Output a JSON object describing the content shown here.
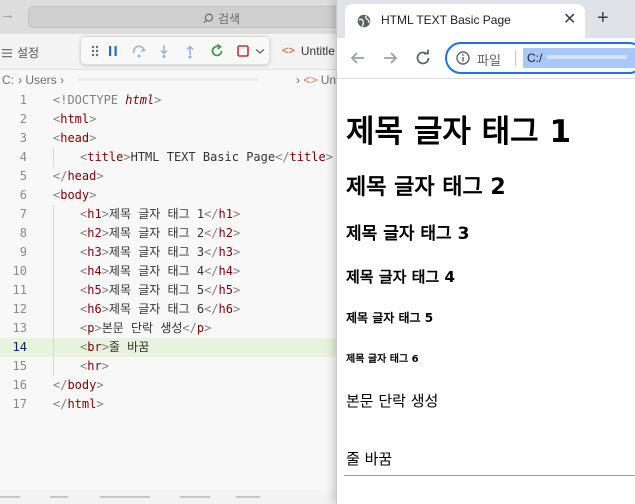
{
  "vscode": {
    "search_placeholder": "검색",
    "settings_label": "설정",
    "tab_label": "Untitle",
    "breadcrumb": {
      "drive": "C:",
      "folder": "Users",
      "right_tag": "<>",
      "right_label": "Untit"
    },
    "code_lines": [
      {
        "num": "1",
        "parts": [
          [
            "b",
            "<!DOCTYPE "
          ],
          [
            "d",
            "html"
          ],
          [
            "b",
            ">"
          ]
        ]
      },
      {
        "num": "2",
        "parts": [
          [
            "b",
            "<"
          ],
          [
            "t",
            "html"
          ],
          [
            "b",
            ">"
          ]
        ]
      },
      {
        "num": "3",
        "parts": [
          [
            "b",
            "<"
          ],
          [
            "t",
            "head"
          ],
          [
            "b",
            ">"
          ]
        ]
      },
      {
        "num": "4",
        "parts": [
          [
            "b",
            "<"
          ],
          [
            "t",
            "title"
          ],
          [
            "b",
            ">"
          ],
          [
            "x",
            "HTML TEXT Basic Page"
          ],
          [
            "b",
            "</"
          ],
          [
            "t",
            "title"
          ],
          [
            "b",
            ">"
          ]
        ]
      },
      {
        "num": "5",
        "parts": [
          [
            "b",
            "</"
          ],
          [
            "t",
            "head"
          ],
          [
            "b",
            ">"
          ]
        ]
      },
      {
        "num": "6",
        "parts": [
          [
            "b",
            "<"
          ],
          [
            "t",
            "body"
          ],
          [
            "b",
            ">"
          ]
        ]
      },
      {
        "num": "7",
        "parts": [
          [
            "b",
            "<"
          ],
          [
            "t",
            "h1"
          ],
          [
            "b",
            ">"
          ],
          [
            "x",
            "제목 글자 태그 1"
          ],
          [
            "b",
            "</"
          ],
          [
            "t",
            "h1"
          ],
          [
            "b",
            ">"
          ]
        ]
      },
      {
        "num": "8",
        "parts": [
          [
            "b",
            "<"
          ],
          [
            "t",
            "h2"
          ],
          [
            "b",
            ">"
          ],
          [
            "x",
            "제목 글자 태그 2"
          ],
          [
            "b",
            "</"
          ],
          [
            "t",
            "h2"
          ],
          [
            "b",
            ">"
          ]
        ]
      },
      {
        "num": "9",
        "parts": [
          [
            "b",
            "<"
          ],
          [
            "t",
            "h3"
          ],
          [
            "b",
            ">"
          ],
          [
            "x",
            "제목 글자 태그 3"
          ],
          [
            "b",
            "</"
          ],
          [
            "t",
            "h3"
          ],
          [
            "b",
            ">"
          ]
        ]
      },
      {
        "num": "10",
        "parts": [
          [
            "b",
            "<"
          ],
          [
            "t",
            "h4"
          ],
          [
            "b",
            ">"
          ],
          [
            "x",
            "제목 글자 태그 4"
          ],
          [
            "b",
            "</"
          ],
          [
            "t",
            "h4"
          ],
          [
            "b",
            ">"
          ]
        ]
      },
      {
        "num": "11",
        "parts": [
          [
            "b",
            "<"
          ],
          [
            "t",
            "h5"
          ],
          [
            "b",
            ">"
          ],
          [
            "x",
            "제목 글자 태그 5"
          ],
          [
            "b",
            "</"
          ],
          [
            "t",
            "h5"
          ],
          [
            "b",
            ">"
          ]
        ]
      },
      {
        "num": "12",
        "parts": [
          [
            "b",
            "<"
          ],
          [
            "t",
            "h6"
          ],
          [
            "b",
            ">"
          ],
          [
            "x",
            "제목 글자 태그 6"
          ],
          [
            "b",
            "</"
          ],
          [
            "t",
            "h6"
          ],
          [
            "b",
            ">"
          ]
        ]
      },
      {
        "num": "13",
        "parts": [
          [
            "b",
            "<"
          ],
          [
            "t",
            "p"
          ],
          [
            "b",
            ">"
          ],
          [
            "x",
            "본문 단락 생성"
          ],
          [
            "b",
            "</"
          ],
          [
            "t",
            "p"
          ],
          [
            "b",
            ">"
          ]
        ]
      },
      {
        "num": "14",
        "parts": [
          [
            "b",
            "<"
          ],
          [
            "t",
            "br"
          ],
          [
            "b",
            ">"
          ],
          [
            "x",
            "줄 바꿈"
          ]
        ]
      },
      {
        "num": "15",
        "parts": [
          [
            "b",
            "<"
          ],
          [
            "t",
            "hr"
          ],
          [
            "b",
            ">"
          ]
        ]
      },
      {
        "num": "16",
        "parts": [
          [
            "b",
            "</"
          ],
          [
            "t",
            "body"
          ],
          [
            "b",
            ">"
          ]
        ]
      },
      {
        "num": "17",
        "parts": [
          [
            "b",
            "</"
          ],
          [
            "t",
            "html"
          ],
          [
            "b",
            ">"
          ]
        ]
      }
    ],
    "active_line": "14",
    "colors": {
      "tag": "#800000",
      "bracket": "#808080",
      "active_line_bg": "#e8f3df"
    }
  },
  "browser": {
    "tab_title": "HTML TEXT Basic Page",
    "tab_close_glyph": "✕",
    "new_tab_glyph": "+",
    "omnibox": {
      "scheme_label": "파일",
      "url_start": "C:/"
    },
    "page": {
      "h1": "제목 글자 태그 1",
      "h2": "제목 글자 태그 2",
      "h3": "제목 글자 태그 3",
      "h4": "제목 글자 태그 4",
      "h5": "제목 글자 태그 5",
      "h6": "제목 글자 태그 6",
      "paragraph": "본문 단락 생성",
      "br_text": "줄 바꿈"
    },
    "colors": {
      "omnibox_focus": "#1a73e8",
      "url_selection": "#a8c7fa"
    }
  }
}
